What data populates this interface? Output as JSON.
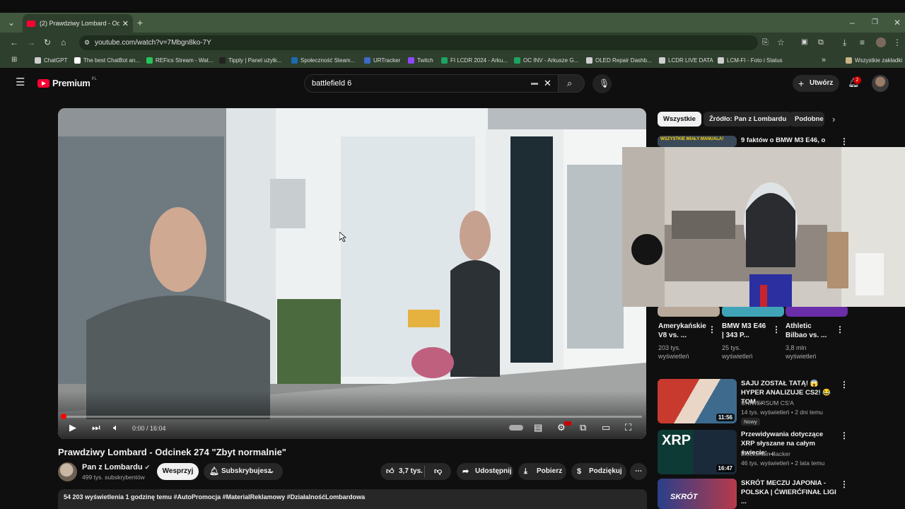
{
  "browser": {
    "tab_title": "(2) Prawdziwy Lombard - Odcin",
    "url": "youtube.com/watch?v=7Mbgn8ko-7Y",
    "bookmarks": [
      {
        "label": "ChatGPT",
        "color": "#cfcfcf"
      },
      {
        "label": "The best ChatBot an...",
        "color": "#ffffff"
      },
      {
        "label": "REFics Stream - Wat...",
        "color": "#26c45c"
      },
      {
        "label": "Tipply | Panel użytk...",
        "color": "#222222"
      },
      {
        "label": "Społeczność Steam...",
        "color": "#1b6bb0"
      },
      {
        "label": "URTracker",
        "color": "#3f6ac8"
      },
      {
        "label": "Twitch",
        "color": "#9146ff"
      },
      {
        "label": "FI LCDR 2024 - Arku...",
        "color": "#1ea362"
      },
      {
        "label": "OC INV - Arkusze G...",
        "color": "#1ea362"
      },
      {
        "label": "OLED Repair Dashb...",
        "color": "#cfcfcf"
      },
      {
        "label": "LCDR LIVE DATA",
        "color": "#cfcfcf"
      },
      {
        "label": "LCM-FI - Foto i Status",
        "color": "#cfcfcf"
      }
    ],
    "bookmarks_all": "Wszystkie zakładki"
  },
  "header": {
    "logo_text": "Premium",
    "logo_region": "PL",
    "search_value": "battlefield 6",
    "create_label": "Utwórz",
    "notification_count": "2"
  },
  "player": {
    "time": "0:00 / 16:04",
    "progress": 0.0
  },
  "video": {
    "title": "Prawdziwy Lombard - Odcinek 274 \"Zbyt normalnie\"",
    "channel": "Pan z Lombardu",
    "subscribers": "499 tys. subskrybentów",
    "support_label": "Wesprzyj",
    "subscribed_label": "Subskrybujesz",
    "likes": "3,7 tys.",
    "share_label": "Udostępnij",
    "download_label": "Pobierz",
    "thanks_label": "Podziękuj",
    "description_line": "54 203 wyświetlenia  1 godzinę temu  #AutoPromocja #MaterialReklamowy #DziałalnośćLombardowa"
  },
  "sidebar": {
    "chips": [
      "Wszystkie",
      "Źródło: Pan z Lombardu",
      "Podobne"
    ],
    "top_item": {
      "title": "9 faktów o BMW M3 E46, o",
      "thumb_text": "WSZYSTKIE MIAŁY MANUALA!"
    },
    "shorts": [
      {
        "title": "Amerykańskie V8 vs. ...",
        "views": "203 tys. wyświetleń"
      },
      {
        "title": "BMW M3 E46 | 343 P...",
        "views": "25 tys. wyświetleń"
      },
      {
        "title": "Athletic Bilbao vs. ...",
        "views": "3,8 mln wyświetleń"
      }
    ],
    "items": [
      {
        "title": "SAJU ZOSTAŁ TATĄ! 😱 HYPER ANALIZUJE CS2! 😂 TOM ...",
        "channel": "UNIWERSUM CS'A",
        "meta": "14 tys. wyświetleń • 2 dni temu",
        "badge": "Nowy",
        "duration": "11:56"
      },
      {
        "title": "Przewidywania dotyczące XRP słyszane na całym świecie: ...",
        "channel": "Blockchain Backer",
        "meta": "46 tys. wyświetleń • 2 lata temu",
        "duration": "16:47",
        "thumb_text": "XRP"
      },
      {
        "title": "SKRÓT MECZU JAPONIA - POLSKA | ĆWIERĆFINAŁ LIGI ...",
        "thumb_text": "SKRÓT"
      }
    ]
  },
  "colors": {
    "accent": "#ff0033",
    "chrome_green": "#2e402d",
    "tabbar_green": "#41583f"
  }
}
